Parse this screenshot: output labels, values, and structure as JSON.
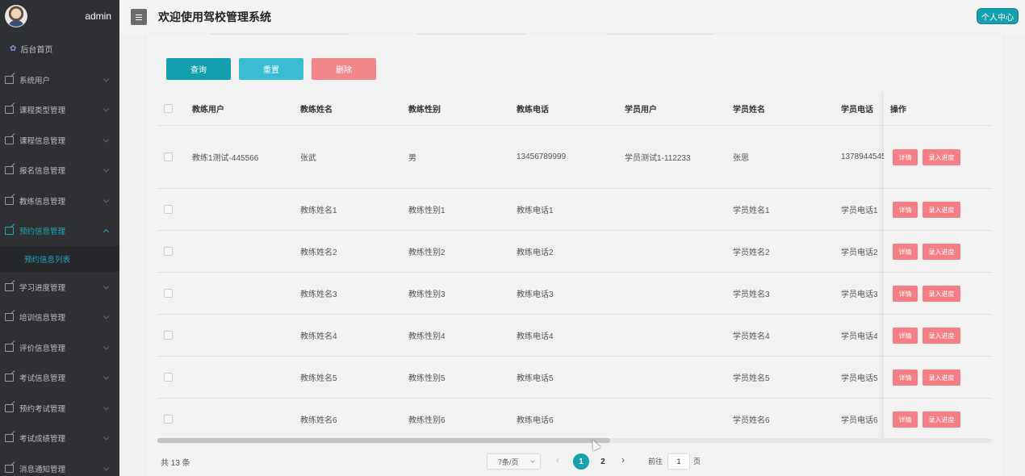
{
  "sidebar": {
    "username": "admin",
    "home": "后台首页",
    "items": [
      {
        "label": "系统用户",
        "active": false
      },
      {
        "label": "课程类型管理",
        "active": false
      },
      {
        "label": "课程信息管理",
        "active": false
      },
      {
        "label": "报名信息管理",
        "active": false
      },
      {
        "label": "教练信息管理",
        "active": false
      },
      {
        "label": "预约信息管理",
        "active": true
      },
      {
        "label": "学习进度管理",
        "active": false
      },
      {
        "label": "培训信息管理",
        "active": false
      },
      {
        "label": "评价信息管理",
        "active": false
      },
      {
        "label": "考试信息管理",
        "active": false
      },
      {
        "label": "预约考试管理",
        "active": false
      },
      {
        "label": "考试成绩管理",
        "active": false
      },
      {
        "label": "消息通知管理",
        "active": false
      }
    ],
    "sub_item": "预约信息列表"
  },
  "header": {
    "title": "欢迎使用驾校管理系统",
    "profile_button": "个人中心"
  },
  "toolbar": {
    "query": "查询",
    "reset": "重置",
    "delete": "删除"
  },
  "table": {
    "columns": [
      "教练用户",
      "教练姓名",
      "教练性别",
      "教练电话",
      "学员用户",
      "学员姓名",
      "学员电话",
      "操作"
    ],
    "rows": [
      [
        "教练1测试-445566",
        "张武",
        "男",
        "13456789999",
        "学员测试1-112233",
        "张思",
        "1378944545"
      ],
      [
        "",
        "教练姓名1",
        "教练性别1",
        "教练电话1",
        "",
        "学员姓名1",
        "学员电话1"
      ],
      [
        "",
        "教练姓名2",
        "教练性别2",
        "教练电话2",
        "",
        "学员姓名2",
        "学员电话2"
      ],
      [
        "",
        "教练姓名3",
        "教练性别3",
        "教练电话3",
        "",
        "学员姓名3",
        "学员电话3"
      ],
      [
        "",
        "教练姓名4",
        "教练性别4",
        "教练电话4",
        "",
        "学员姓名4",
        "学员电话4"
      ],
      [
        "",
        "教练姓名5",
        "教练性别5",
        "教练电话5",
        "",
        "学员姓名5",
        "学员电话5"
      ],
      [
        "",
        "教练姓名6",
        "教练性别6",
        "教练电话6",
        "",
        "学员姓名6",
        "学员电话6"
      ]
    ],
    "detail_button": "详情",
    "progress_button": "录入进度"
  },
  "pagination": {
    "total": "共 13 条",
    "page_size": "7条/页",
    "pages": [
      "1",
      "2"
    ],
    "current_page": "1",
    "goto_prefix": "前往",
    "goto_value": "1",
    "goto_suffix": "页"
  }
}
